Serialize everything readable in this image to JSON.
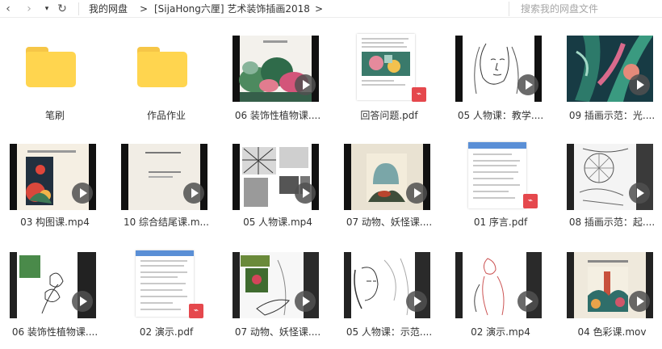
{
  "nav": {
    "back_glyph": "‹",
    "forward_glyph": "›",
    "dropdown_glyph": "▾",
    "refresh_glyph": "↻"
  },
  "breadcrumb": {
    "home": "我的网盘",
    "separator": ">",
    "folder": "[SijaHong六厘] 艺术装饰插画2018"
  },
  "search": {
    "placeholder": "搜索我的网盘文件"
  },
  "colors": {
    "folder": "#ffd54f",
    "pdf_badge": "#e5484d",
    "play_button": "#505050"
  },
  "files": [
    {
      "name": "笔刷",
      "type": "folder"
    },
    {
      "name": "作品作业",
      "type": "folder"
    },
    {
      "name": "06 装饰性植物课....",
      "type": "video"
    },
    {
      "name": "回答问题.pdf",
      "type": "pdf"
    },
    {
      "name": "05 人物课：教学....",
      "type": "video"
    },
    {
      "name": "09 插画示范：光....",
      "type": "video"
    },
    {
      "name": "03 构图课.mp4",
      "type": "video"
    },
    {
      "name": "10 综合结尾课.m...",
      "type": "video"
    },
    {
      "name": "05 人物课.mp4",
      "type": "video"
    },
    {
      "name": "07 动物、妖怪课....",
      "type": "video"
    },
    {
      "name": "01 序言.pdf",
      "type": "pdf"
    },
    {
      "name": "08 插画示范：起....",
      "type": "video"
    },
    {
      "name": "06 装饰性植物课....",
      "type": "video"
    },
    {
      "name": "02 演示.pdf",
      "type": "pdf"
    },
    {
      "name": "07 动物、妖怪课....",
      "type": "video"
    },
    {
      "name": "05 人物课：示范....",
      "type": "video"
    },
    {
      "name": "02 演示.mp4",
      "type": "video"
    },
    {
      "name": "04 色彩课.mov",
      "type": "video"
    }
  ]
}
